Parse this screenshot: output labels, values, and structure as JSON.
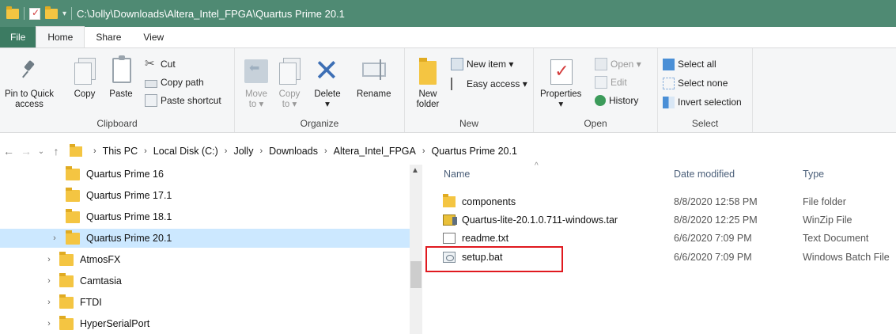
{
  "window": {
    "title": "C:\\Jolly\\Downloads\\Altera_Intel_FPGA\\Quartus Prime 20.1"
  },
  "tabs": [
    {
      "label": "File"
    },
    {
      "label": "Home"
    },
    {
      "label": "Share"
    },
    {
      "label": "View"
    }
  ],
  "ribbon": {
    "clipboard": {
      "group_label": "Clipboard",
      "pin_label_1": "Pin to Quick",
      "pin_label_2": "access",
      "copy_label": "Copy",
      "paste_label": "Paste",
      "cut_label": "Cut",
      "copy_path_label": "Copy path",
      "paste_shortcut_label": "Paste shortcut"
    },
    "organize": {
      "group_label": "Organize",
      "move_to_1": "Move",
      "move_to_2": "to ▾",
      "copy_to_1": "Copy",
      "copy_to_2": "to ▾",
      "delete_label": "Delete",
      "delete_arrow": "▾",
      "rename_label": "Rename"
    },
    "new": {
      "group_label": "New",
      "new_folder_1": "New",
      "new_folder_2": "folder",
      "new_item_label": "New item ▾",
      "easy_access_label": "Easy access ▾"
    },
    "open": {
      "group_label": "Open",
      "properties_label": "Properties",
      "properties_arrow": "▾",
      "open_label": "Open ▾",
      "edit_label": "Edit",
      "history_label": "History"
    },
    "select": {
      "group_label": "Select",
      "select_all_label": "Select all",
      "select_none_label": "Select none",
      "invert_selection_label": "Invert selection"
    }
  },
  "address": {
    "crumbs": [
      "This PC",
      "Local Disk (C:)",
      "Jolly",
      "Downloads",
      "Altera_Intel_FPGA",
      "Quartus Prime 20.1"
    ],
    "sep": "›"
  },
  "nav_pane": {
    "items": [
      {
        "label": "Quartus Prime 16"
      },
      {
        "label": "Quartus Prime 17.1"
      },
      {
        "label": "Quartus Prime 18.1"
      },
      {
        "label": "Quartus Prime 20.1",
        "selected": true
      },
      {
        "label": "AtmosFX"
      },
      {
        "label": "Camtasia"
      },
      {
        "label": "FTDI"
      },
      {
        "label": "HyperSerialPort"
      }
    ]
  },
  "file_list": {
    "columns": {
      "name": "Name",
      "date": "Date modified",
      "type": "Type"
    },
    "rows": [
      {
        "name": "components",
        "date": "8/8/2020 12:58 PM",
        "type": "File folder",
        "icon": "folder-icon"
      },
      {
        "name": "Quartus-lite-20.1.0.711-windows.tar",
        "date": "8/8/2020 12:25 PM",
        "type": "WinZip File",
        "icon": "winzip-icon"
      },
      {
        "name": "readme.txt",
        "date": "6/6/2020 7:09 PM",
        "type": "Text Document",
        "icon": "text-file-icon"
      },
      {
        "name": "setup.bat",
        "date": "6/6/2020 7:09 PM",
        "type": "Windows Batch File",
        "icon": "batch-file-icon"
      }
    ]
  },
  "colors": {
    "titlebar": "#4f8a73",
    "file_tab": "#3c7b62",
    "selection": "#cce8ff",
    "highlight_box": "#e0191f",
    "folder": "#f4c542"
  }
}
